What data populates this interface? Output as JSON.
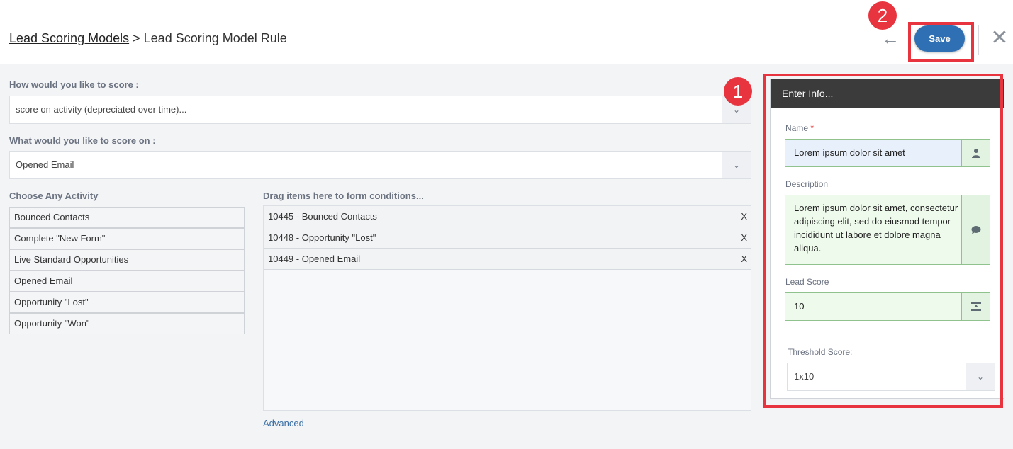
{
  "header": {
    "breadcrumb_link": "Lead Scoring Models",
    "breadcrumb_sep": ">",
    "breadcrumb_current": "Lead Scoring Model Rule",
    "save_label": "Save"
  },
  "badges": {
    "one": "1",
    "two": "2"
  },
  "score_type": {
    "label": "How would you like to score :",
    "value": "score on activity (depreciated over time)..."
  },
  "score_on": {
    "label": "What would you like to score on :",
    "value": "Opened Email"
  },
  "activities": {
    "label": "Choose Any Activity",
    "items": [
      "Bounced Contacts",
      "Complete \"New Form\"",
      "Live Standard Opportunities",
      "Opened Email",
      "Opportunity \"Lost\"",
      "Opportunity \"Won\""
    ]
  },
  "conditions": {
    "label": "Drag items here to form conditions...",
    "items": [
      "10445 - Bounced Contacts",
      "10448 - Opportunity \"Lost\"",
      "10449 - Opened Email"
    ],
    "remove_label": "X"
  },
  "advanced_label": "Advanced",
  "info_panel": {
    "title": "Enter Info...",
    "name_label": "Name",
    "required_mark": "*",
    "name_value": "Lorem ipsum dolor sit amet",
    "description_label": "Description",
    "description_value": "Lorem ipsum dolor sit amet, consectetur adipiscing elit, sed do eiusmod tempor incididunt ut labore et dolore magna aliqua.",
    "lead_score_label": "Lead Score",
    "lead_score_value": "10",
    "threshold_label": "Threshold Score:",
    "threshold_value": "1x10"
  },
  "colors": {
    "accent": "#2f6fb3",
    "highlight": "#e8343f",
    "panel_header": "#3b3b3b",
    "valid_green": "#8fc28c"
  },
  "icons": [
    "back-arrow-icon",
    "close-icon",
    "chevron-down-icon",
    "user-icon",
    "comment-icon",
    "score-icon"
  ]
}
